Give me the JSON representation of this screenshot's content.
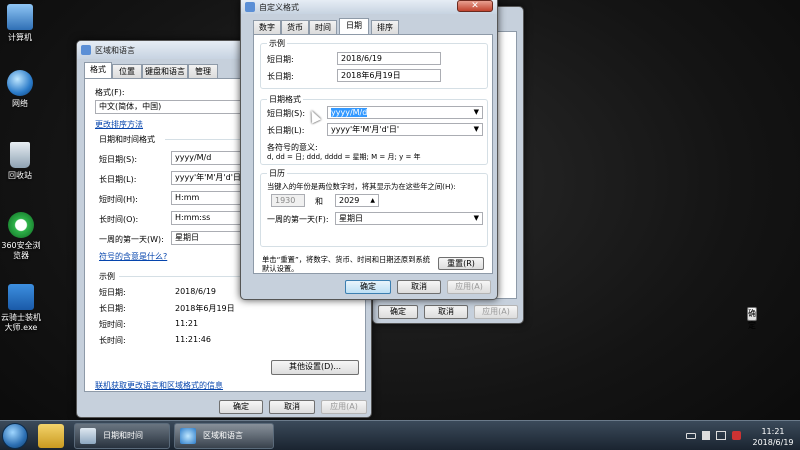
{
  "desktop": {
    "icons": [
      {
        "label": "计算机"
      },
      {
        "label": "网络"
      },
      {
        "label": "回收站"
      },
      {
        "label": "360安全浏览器"
      },
      {
        "label": "云骑士装机大师.exe"
      }
    ]
  },
  "region_window": {
    "title": "区域和语言",
    "tabs": [
      "格式",
      "位置",
      "键盘和语言",
      "管理"
    ],
    "format_label": "格式(F):",
    "format_value": "中文(简体，中国)",
    "sort_link": "更改排序方法",
    "datetime_group": "日期和时间格式",
    "rows": [
      {
        "label": "短日期(S):",
        "value": "yyyy/M/d"
      },
      {
        "label": "长日期(L):",
        "value": "yyyy'年'M'月'd'日'"
      },
      {
        "label": "短时间(H):",
        "value": "H:mm"
      },
      {
        "label": "长时间(O):",
        "value": "H:mm:ss"
      },
      {
        "label": "一周的第一天(W):",
        "value": "星期日"
      }
    ],
    "notation_link": "符号的含意是什么?",
    "example_group": "示例",
    "examples": [
      {
        "label": "短日期:",
        "value": "2018/6/19"
      },
      {
        "label": "长日期:",
        "value": "2018年6月19日"
      },
      {
        "label": "短时间:",
        "value": "11:21"
      },
      {
        "label": "长时间:",
        "value": "11:21:46"
      }
    ],
    "other_settings_btn": "其他设置(D)...",
    "online_link": "联机获取更改语言和区域格式的信息",
    "ok": "确定",
    "cancel": "取消",
    "apply": "应用(A)"
  },
  "custom_window": {
    "title": "自定义格式",
    "tabs": [
      "数字",
      "货币",
      "时间",
      "日期",
      "排序"
    ],
    "example_group": "示例",
    "short_date_label": "短日期:",
    "short_date_value": "2018/6/19",
    "long_date_label": "长日期:",
    "long_date_value": "2018年6月19日",
    "format_group": "日期格式",
    "fmt_short_label": "短日期(S):",
    "fmt_short_value": "yyyy/M/d",
    "fmt_long_label": "长日期(L):",
    "fmt_long_value": "yyyy'年'M'月'd'日'",
    "meaning_title": "各符号的意义:",
    "meaning_text": "d, dd = 日;  ddd, dddd = 星期;  M = 月;  y = 年",
    "calendar_group": "日历",
    "calendar_desc": "当键入的年份是两位数字时，将其显示为在这些年之间(H):",
    "year_from": "1930",
    "and_label": "和",
    "year_to": "2029",
    "first_day_label": "一周的第一天(F):",
    "first_day_value": "星期日",
    "reset_desc": "单击“重置”，将数字、货币、时间和日期还原到系统默认设置。",
    "reset_btn": "重置(R)",
    "ok": "确定",
    "cancel": "取消",
    "apply": "应用(A)"
  },
  "back_window": {
    "ok": "确定",
    "cancel": "取消",
    "apply": "应用(A)"
  },
  "taskbar": {
    "items": [
      {
        "label": "日期和时间"
      },
      {
        "label": "区域和语言"
      }
    ],
    "time": "11:21",
    "date": "2018/6/19"
  }
}
